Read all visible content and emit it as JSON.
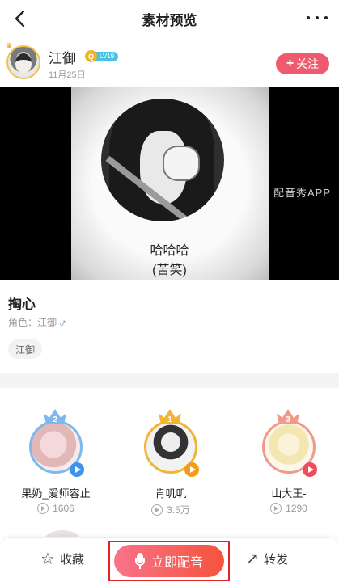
{
  "header": {
    "title": "素材预览"
  },
  "user": {
    "name": "江御",
    "level_icon": "Q",
    "level": "LV19",
    "date": "11月25日",
    "follow_label": "关注",
    "follow_plus": "+"
  },
  "video": {
    "caption_line1": "哈哈哈",
    "caption_line2": "(苦笑)",
    "watermark": "配音秀APP"
  },
  "material": {
    "title": "掏心",
    "role_label": "角色：江御",
    "role_gender_icon": "male-icon",
    "tag": "江御"
  },
  "ranking": [
    {
      "rank": "2",
      "name": "果奶_爱师容止",
      "plays": "1606",
      "color": "#7eb8ee"
    },
    {
      "rank": "1",
      "name": "肯叽叽",
      "plays": "3.5万",
      "color": "#f3b432"
    },
    {
      "rank": "3",
      "name": "山大王-",
      "plays": "1290",
      "color": "#f19a8a"
    }
  ],
  "bottom_bar": {
    "collect_label": "收藏",
    "record_label": "立即配音",
    "share_label": "转发",
    "accent_color": "#f6533d"
  }
}
